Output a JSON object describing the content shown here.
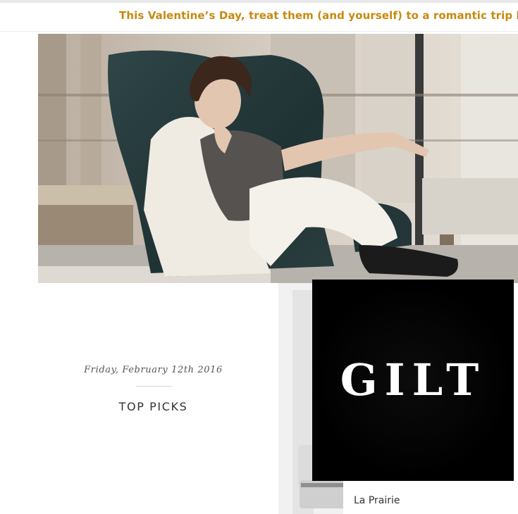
{
  "banner": {
    "text": "This Valentine’s Day, treat them (and yourself) to a romantic trip booked at"
  },
  "hero": {
    "image": "woman-in-leather-armchair-photo"
  },
  "article": {
    "date": "Friday, February 12th 2016",
    "section_title": "TOP PICKS"
  },
  "product": {
    "label": "La Prairie",
    "image": "skincare-jar-photo"
  },
  "logo": {
    "text": "GILT"
  },
  "colors": {
    "banner_text": "#c8890f",
    "logo_bg": "#000000",
    "logo_text": "#ffffff"
  }
}
